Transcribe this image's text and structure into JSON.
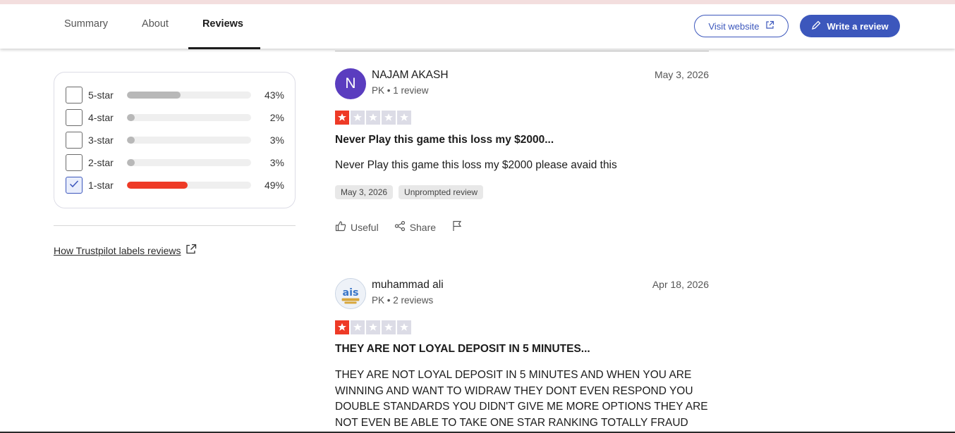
{
  "tabs": [
    {
      "label": "Summary"
    },
    {
      "label": "About"
    },
    {
      "label": "Reviews",
      "active": true
    }
  ],
  "header_buttons": {
    "visit_website": "Visit website",
    "write_review": "Write a review"
  },
  "colors": {
    "accent_blue": "#3c57bc",
    "one_star_red": "#ee3a26",
    "bar_grey": "#b8b8b8",
    "avatar_purple": "#5a3dbf"
  },
  "rating_filter": [
    {
      "label": "5-star",
      "percent": "43%",
      "value": 43,
      "checked": false
    },
    {
      "label": "4-star",
      "percent": "2%",
      "value": 2,
      "checked": false
    },
    {
      "label": "3-star",
      "percent": "3%",
      "value": 3,
      "checked": false
    },
    {
      "label": "2-star",
      "percent": "3%",
      "value": 3,
      "checked": false
    },
    {
      "label": "1-star",
      "percent": "49%",
      "value": 49,
      "checked": true
    }
  ],
  "how_link": "How Trustpilot labels reviews",
  "reviews": [
    {
      "avatar_letter": "N",
      "name": "NAJAM AKASH",
      "meta": "PK • 1 review",
      "date": "May 3, 2026",
      "stars": 1,
      "title": "Never Play this game this loss my $2000...",
      "body": "Never Play this game this loss my $2000 please avaid this",
      "chips": [
        "May 3, 2026",
        "Unprompted review"
      ],
      "actions": {
        "useful": "Useful",
        "share": "Share"
      }
    },
    {
      "avatar_letter": "",
      "name": "muhammad ali",
      "meta": "PK • 2 reviews",
      "date": "Apr 18, 2026",
      "stars": 1,
      "title": "THEY ARE NOT LOYAL DEPOSIT IN 5 MINUTES...",
      "body": "THEY ARE NOT LOYAL DEPOSIT IN 5 MINUTES AND WHEN YOU ARE WINNING AND WANT TO WIDRAW THEY DONT EVEN RESPOND YOU DOUBLE STANDARDS YOU DIDN'T GIVE ME MORE OPTIONS THEY ARE NOT EVEN BE ABLE TO TAKE ONE STAR RANKING TOTALLY FRAUD"
    }
  ]
}
